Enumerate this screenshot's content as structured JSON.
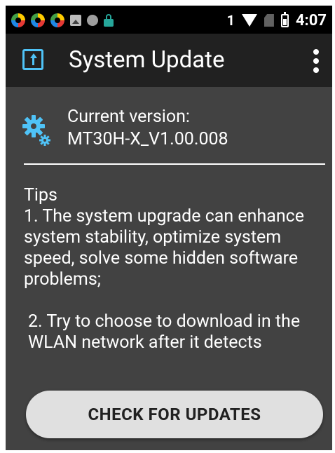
{
  "status_bar": {
    "notification_icons": [
      "swirl-app-icon",
      "swirl-app-icon",
      "swirl-app-icon",
      "image-icon",
      "circle-icon",
      "lock-icon"
    ],
    "sim_count": "1",
    "time": "4:07"
  },
  "app_bar": {
    "title": "System Update",
    "icon": "system-update-icon",
    "menu_icon": "overflow-menu-icon"
  },
  "version": {
    "label": "Current version:",
    "value": "MT30H-X_V1.00.008"
  },
  "tips": {
    "heading": "Tips",
    "item1": "1. The system upgrade can enhance system stability, optimize system speed, solve some hidden software problems;",
    "item2": "2. Try to choose to download in the WLAN network after it detects"
  },
  "action": {
    "check_label": "CHECK FOR UPDATES"
  },
  "colors": {
    "background": "#424242",
    "app_bar": "#212121",
    "accent": "#4fc3f7",
    "button": "#e0e0e0"
  }
}
